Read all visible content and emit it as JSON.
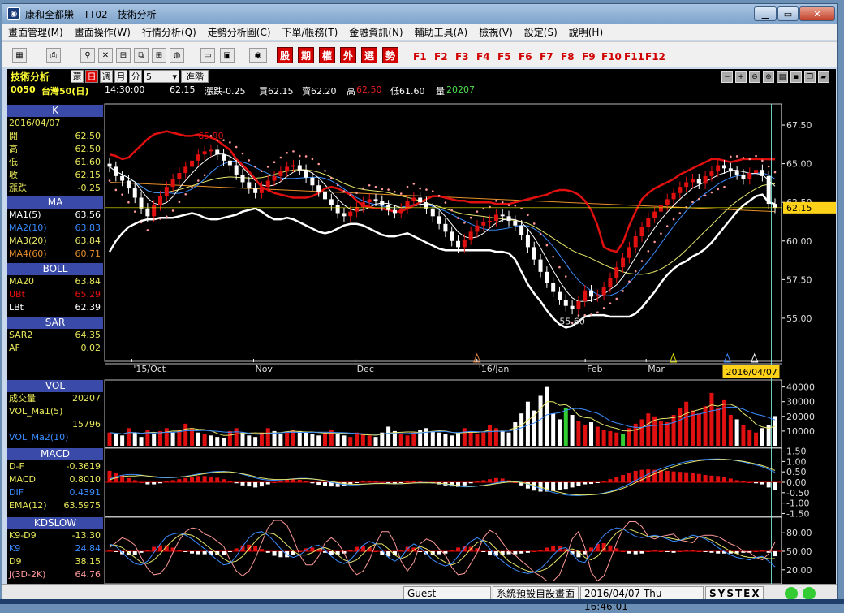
{
  "window": {
    "title": "康和全都賺 - TT02 - 技術分析",
    "min": "▁",
    "max": "▭",
    "close": "✕"
  },
  "menu": [
    "畫面管理(M)",
    "畫面操作(W)",
    "行情分析(Q)",
    "走勢分析圖(C)",
    "下單/帳務(T)",
    "金融資訊(N)",
    "輔助工具(A)",
    "檢視(V)",
    "設定(S)",
    "說明(H)"
  ],
  "toolbar": {
    "red_buttons": [
      "股",
      "期",
      "權",
      "外",
      "選",
      "勢"
    ],
    "fkeys": [
      "F1",
      "F2",
      "F3",
      "F4",
      "F5",
      "F6",
      "F7",
      "F8",
      "F9",
      "F10",
      "F11",
      "F12"
    ]
  },
  "header": {
    "title": "技術分析",
    "btn_restore": "還",
    "btn_day": "日",
    "btn_week": "週",
    "btn_month": "月",
    "btn_min": "分",
    "period": "5",
    "advanced": "進階",
    "icons": [
      "minus-icon",
      "plus-icon",
      "zoom-out-icon",
      "zoom-in-icon",
      "chat-icon",
      "save-icon",
      "window-icon",
      "folder-icon"
    ]
  },
  "quote": {
    "code": "0050",
    "name": "台灣50(日)",
    "time": "14:30:00",
    "price": "62.15",
    "chg": "漲跌-0.25",
    "bid": "買62.15",
    "ask": "賣62.20",
    "high_l": "高",
    "high": "62.50",
    "low": "低61.60",
    "vol_l": "量",
    "vol": "20207"
  },
  "side": {
    "k": {
      "title": "K",
      "date": "2016/04/07",
      "rows": [
        [
          "開",
          "62.50"
        ],
        [
          "高",
          "62.50"
        ],
        [
          "低",
          "61.60"
        ],
        [
          "收",
          "62.15"
        ],
        [
          "漲跌",
          "-0.25"
        ]
      ]
    },
    "ma": {
      "title": "MA",
      "rows": [
        [
          "MA1(5)",
          "63.56"
        ],
        [
          "MA2(10)",
          "63.83"
        ],
        [
          "MA3(20)",
          "63.84"
        ],
        [
          "MA4(60)",
          "60.71"
        ]
      ]
    },
    "boll": {
      "title": "BOLL",
      "rows": [
        [
          "MA20",
          "63.84"
        ],
        [
          "UBt",
          "65.29"
        ],
        [
          "LBt",
          "62.39"
        ]
      ]
    },
    "sar": {
      "title": "SAR",
      "rows": [
        [
          "SAR2",
          "64.35"
        ],
        [
          "AF",
          "0.02"
        ]
      ]
    },
    "vol": {
      "title": "VOL",
      "rows": [
        [
          "成交量",
          "20207"
        ],
        [
          "VOL_Ma1(5)",
          ""
        ],
        [
          "",
          "15796"
        ],
        [
          "VOL_Ma2(10)",
          ""
        ]
      ]
    },
    "macd": {
      "title": "MACD",
      "rows": [
        [
          "D-F",
          "-0.3619"
        ],
        [
          "MACD",
          "0.8010"
        ],
        [
          "DIF",
          "0.4391"
        ],
        [
          "EMA(12)",
          "63.5975"
        ]
      ]
    },
    "kd": {
      "title": "KDSLOW",
      "rows": [
        [
          "K9-D9",
          "-13.30"
        ],
        [
          "K9",
          "24.84"
        ],
        [
          "D9",
          "38.15"
        ],
        [
          "J(3D-2K)",
          "64.76"
        ]
      ]
    }
  },
  "colors": {
    "ma1": "#ffffff",
    "ma2": "#3a8cff",
    "ma3": "#e6e66a",
    "ma4": "#e8902a",
    "ub": "#e01010",
    "lb": "#ffffff",
    "up": "#e01010",
    "down": "#ffffff",
    "sar": "#ff9999"
  },
  "chart_data": [
    {
      "type": "candlestick",
      "ylim": [
        53.0,
        68.5
      ],
      "yticks": [
        "67.50",
        "65.00",
        "62.50",
        "60.00",
        "57.50",
        "55.00"
      ],
      "xlabels": [
        "'15/Oct",
        "Nov",
        "Dec",
        "'16/Jan",
        "Feb",
        "Mar"
      ],
      "last_price": "62.15",
      "current_date": "2016/04/07",
      "annotations": [
        "65.90",
        "55.60"
      ],
      "close": [
        64.8,
        64.2,
        63.9,
        63.4,
        62.8,
        62.1,
        61.6,
        62.3,
        62.9,
        63.5,
        64.0,
        64.4,
        64.8,
        65.2,
        65.6,
        65.8,
        65.9,
        65.6,
        65.2,
        64.9,
        64.3,
        63.8,
        63.4,
        63.1,
        63.5,
        63.9,
        64.2,
        64.5,
        64.8,
        64.9,
        64.6,
        64.1,
        63.6,
        63.2,
        62.7,
        62.3,
        61.8,
        61.6,
        61.9,
        62.2,
        62.5,
        62.7,
        62.6,
        62.3,
        62.0,
        61.8,
        62.1,
        62.6,
        62.8,
        62.5,
        62.1,
        61.6,
        61.1,
        60.6,
        60.0,
        59.6,
        60.1,
        60.6,
        61.0,
        61.2,
        61.3,
        61.7,
        61.6,
        61.3,
        61.0,
        60.4,
        59.6,
        58.8,
        58.0,
        57.3,
        56.7,
        56.2,
        55.8,
        55.6,
        56.1,
        56.8,
        56.4,
        56.5,
        57.0,
        57.6,
        58.3,
        58.9,
        59.6,
        60.3,
        60.9,
        61.5,
        61.9,
        62.3,
        62.7,
        63.1,
        63.5,
        63.8,
        64.0,
        63.7,
        64.2,
        64.5,
        64.9,
        64.7,
        64.5,
        64.3,
        64.0,
        64.4,
        64.6,
        64.2,
        62.4,
        62.15
      ],
      "ma4": [
        63.8,
        63.7,
        63.6,
        63.5,
        63.4,
        63.3,
        63.2,
        63.1,
        63.0,
        62.9,
        62.8,
        62.7,
        62.6,
        62.5,
        62.4,
        62.3,
        62.2,
        62.1,
        62.0,
        61.9
      ],
      "ub": [
        65.6,
        65.5,
        65.3,
        65.4,
        65.8,
        66.2,
        66.6,
        66.9,
        67.0,
        67.1,
        67.0,
        66.9,
        66.8,
        66.8,
        66.9,
        66.8,
        66.7,
        66.5,
        66.2,
        65.9,
        65.3,
        64.9,
        64.5,
        64.0,
        63.5,
        63.3,
        63.1,
        63.0,
        62.9,
        62.8,
        62.8,
        62.8,
        62.9,
        63.1,
        63.4,
        63.5,
        63.4,
        63.2,
        63.0,
        62.6,
        62.3,
        62.2,
        62.1,
        62.1,
        62.0,
        61.9,
        61.9,
        62.1,
        62.3,
        62.5,
        62.7,
        62.9,
        62.9,
        62.8,
        62.7,
        62.6,
        62.6,
        62.5,
        62.5,
        62.5,
        62.5,
        62.4,
        62.4,
        62.4,
        62.5,
        62.6,
        62.7,
        62.8,
        62.9,
        63.0,
        63.2,
        63.3,
        63.3,
        63.2,
        63.0,
        62.6,
        62.0,
        61.0,
        59.6,
        59.4,
        59.3,
        59.9,
        61.0,
        61.9,
        62.7,
        63.1,
        63.4,
        63.6,
        63.8,
        64.0,
        64.3,
        64.5,
        64.7,
        64.9,
        65.1,
        65.3,
        65.3,
        65.2,
        65.1,
        65.2,
        65.3,
        65.3,
        65.3,
        65.3,
        65.29,
        65.29
      ],
      "lb": [
        59.3,
        60.0,
        60.5,
        60.9,
        61.1,
        61.3,
        61.4,
        61.4,
        61.5,
        61.5,
        61.5,
        61.6,
        61.7,
        61.8,
        61.7,
        61.5,
        61.4,
        61.4,
        61.5,
        61.6,
        61.7,
        61.9,
        62.0,
        62.1,
        61.9,
        61.6,
        61.4,
        61.4,
        61.5,
        61.4,
        61.2,
        61.0,
        60.8,
        60.6,
        60.5,
        60.6,
        60.8,
        61.0,
        61.1,
        61.1,
        61.0,
        60.8,
        60.6,
        60.4,
        60.3,
        60.3,
        60.4,
        60.5,
        60.3,
        60.1,
        59.9,
        59.7,
        59.5,
        59.4,
        59.4,
        59.4,
        59.4,
        59.4,
        59.4,
        59.4,
        59.4,
        59.3,
        59.3,
        59.2,
        58.8,
        58.0,
        57.2,
        56.6,
        56.1,
        55.5,
        55.0,
        54.6,
        54.4,
        54.5,
        54.8,
        55.1,
        55.2,
        55.2,
        55.2,
        55.1,
        55.1,
        55.1,
        55.1,
        55.3,
        55.7,
        56.2,
        56.7,
        57.3,
        57.8,
        58.2,
        58.5,
        58.7,
        59.0,
        59.2,
        59.5,
        59.9,
        60.4,
        60.9,
        61.4,
        61.9,
        62.3,
        62.6,
        62.9,
        63.0,
        62.5,
        62.39
      ]
    },
    {
      "type": "bar",
      "title": "VOL",
      "yticks": [
        "40000",
        "30000",
        "20000",
        "10000"
      ],
      "ylim": [
        0,
        42000
      ],
      "values": [
        9000,
        8000,
        7000,
        12000,
        9000,
        6000,
        11000,
        8000,
        10000,
        12000,
        9000,
        11000,
        15000,
        12000,
        9000,
        8000,
        7000,
        6000,
        5000,
        10000,
        12000,
        9000,
        7000,
        6000,
        9000,
        12000,
        10000,
        8000,
        9000,
        11000,
        10000,
        9000,
        8000,
        7000,
        9000,
        11000,
        8000,
        7000,
        6000,
        9000,
        8000,
        7000,
        6000,
        9000,
        13000,
        10000,
        8000,
        7000,
        9000,
        11000,
        12000,
        10000,
        9000,
        8000,
        7000,
        9000,
        12000,
        10000,
        8000,
        9000,
        14000,
        12000,
        10000,
        9000,
        16000,
        22000,
        30000,
        24000,
        34000,
        40000,
        22000,
        18000,
        26000,
        21000,
        17000,
        14000,
        16000,
        13000,
        11000,
        10000,
        9000,
        8000,
        12000,
        15000,
        18000,
        22000,
        20000,
        17000,
        16000,
        21000,
        26000,
        30000,
        24000,
        22000,
        27000,
        36000,
        26000,
        31000,
        21000,
        18000,
        14000,
        11000,
        9000,
        12000,
        14000,
        20207
      ],
      "up": [
        1,
        0,
        0,
        1,
        0,
        0,
        1,
        0,
        1,
        1,
        0,
        1,
        1,
        1,
        0,
        1,
        0,
        0,
        0,
        1,
        1,
        0,
        0,
        0,
        1,
        1,
        0,
        0,
        1,
        1,
        0,
        0,
        0,
        0,
        1,
        1,
        0,
        0,
        1,
        1,
        1,
        1,
        0,
        0,
        0,
        0,
        1,
        1,
        1,
        0,
        0,
        0,
        0,
        0,
        0,
        0,
        1,
        1,
        1,
        1,
        1,
        1,
        0,
        0,
        0,
        0,
        0,
        0,
        0,
        0,
        0,
        0,
        0,
        0,
        1,
        1,
        0,
        1,
        1,
        1,
        1,
        1,
        1,
        1,
        1,
        1,
        1,
        1,
        1,
        1,
        1,
        1,
        1,
        1,
        1,
        1,
        1,
        1,
        1,
        0,
        1,
        1,
        1,
        0,
        0,
        0
      ]
    },
    {
      "type": "bar",
      "title": "MACD",
      "yticks": [
        "1.50",
        "1.00",
        "0.50",
        "0.00",
        "-0.50",
        "-1.00",
        "-1.50"
      ],
      "ylim": [
        -1.6,
        1.6
      ],
      "values": [
        0.55,
        0.45,
        0.35,
        0.2,
        0.1,
        0.0,
        -0.1,
        -0.1,
        -0.05,
        0.05,
        0.1,
        0.15,
        0.2,
        0.25,
        0.3,
        0.3,
        0.28,
        0.22,
        0.15,
        0.05,
        -0.05,
        -0.15,
        -0.2,
        -0.25,
        -0.2,
        -0.1,
        0.0,
        0.08,
        0.12,
        0.15,
        0.12,
        0.05,
        -0.05,
        -0.12,
        -0.18,
        -0.2,
        -0.22,
        -0.18,
        -0.1,
        -0.02,
        0.05,
        0.08,
        0.06,
        0.0,
        -0.05,
        -0.08,
        -0.02,
        0.05,
        0.08,
        0.05,
        0.0,
        -0.05,
        -0.1,
        -0.15,
        -0.2,
        -0.22,
        -0.15,
        -0.05,
        0.05,
        0.1,
        0.15,
        0.2,
        0.18,
        0.1,
        0.0,
        -0.15,
        -0.3,
        -0.4,
        -0.45,
        -0.45,
        -0.42,
        -0.38,
        -0.32,
        -0.25,
        -0.18,
        -0.1,
        -0.08,
        -0.03,
        0.05,
        0.15,
        0.25,
        0.35,
        0.45,
        0.55,
        0.6,
        0.62,
        0.6,
        0.58,
        0.55,
        0.52,
        0.5,
        0.48,
        0.45,
        0.4,
        0.35,
        0.32,
        0.3,
        0.25,
        0.18,
        0.1,
        0.05,
        0.0,
        -0.05,
        -0.1,
        -0.25,
        -0.3619
      ]
    },
    {
      "type": "line",
      "title": "KDSLOW",
      "yticks": [
        "80.00",
        "50.00",
        "20.00"
      ],
      "ylim": [
        0,
        100
      ],
      "k": [
        62,
        58,
        48,
        38,
        30,
        28,
        34,
        48,
        62,
        74,
        78,
        80,
        76,
        70,
        62,
        54,
        44,
        36,
        28,
        30,
        42,
        58,
        72,
        80,
        82,
        76,
        66,
        54,
        44,
        40,
        44,
        52,
        58,
        60,
        52,
        42,
        34,
        30,
        36,
        48,
        60,
        66,
        62,
        52,
        40,
        34,
        40,
        54,
        62,
        56,
        46,
        36,
        30,
        26,
        30,
        42,
        56,
        66,
        72,
        66,
        54,
        42,
        34,
        26,
        20,
        16,
        14,
        16,
        22,
        32,
        44,
        54,
        56,
        46,
        34,
        32,
        46,
        62,
        76,
        84,
        88,
        86,
        80,
        74,
        72,
        74,
        76,
        74,
        70,
        66,
        68,
        72,
        76,
        74,
        70,
        64,
        56,
        50,
        44,
        40,
        38,
        36,
        40,
        42,
        34,
        24.84
      ],
      "d": [
        60,
        60,
        56,
        48,
        40,
        32,
        30,
        36,
        46,
        58,
        68,
        76,
        78,
        76,
        70,
        62,
        54,
        46,
        38,
        32,
        34,
        42,
        54,
        66,
        76,
        80,
        78,
        70,
        60,
        50,
        44,
        44,
        48,
        54,
        56,
        52,
        44,
        36,
        32,
        36,
        46,
        56,
        62,
        62,
        54,
        44,
        38,
        42,
        52,
        58,
        54,
        46,
        38,
        32,
        28,
        32,
        42,
        54,
        64,
        68,
        64,
        54,
        44,
        34,
        28,
        22,
        18,
        16,
        18,
        22,
        30,
        40,
        50,
        54,
        50,
        40,
        36,
        42,
        54,
        68,
        80,
        86,
        86,
        82,
        78,
        74,
        74,
        74,
        72,
        70,
        68,
        70,
        72,
        74,
        72,
        68,
        62,
        56,
        50,
        46,
        42,
        40,
        40,
        40,
        38,
        38.15
      ]
    }
  ],
  "status": {
    "user": "Guest",
    "layout": "系統預設自設畫面",
    "datetime": "2016/04/07 Thu 16:46:01",
    "brand": "SYSTEX"
  }
}
